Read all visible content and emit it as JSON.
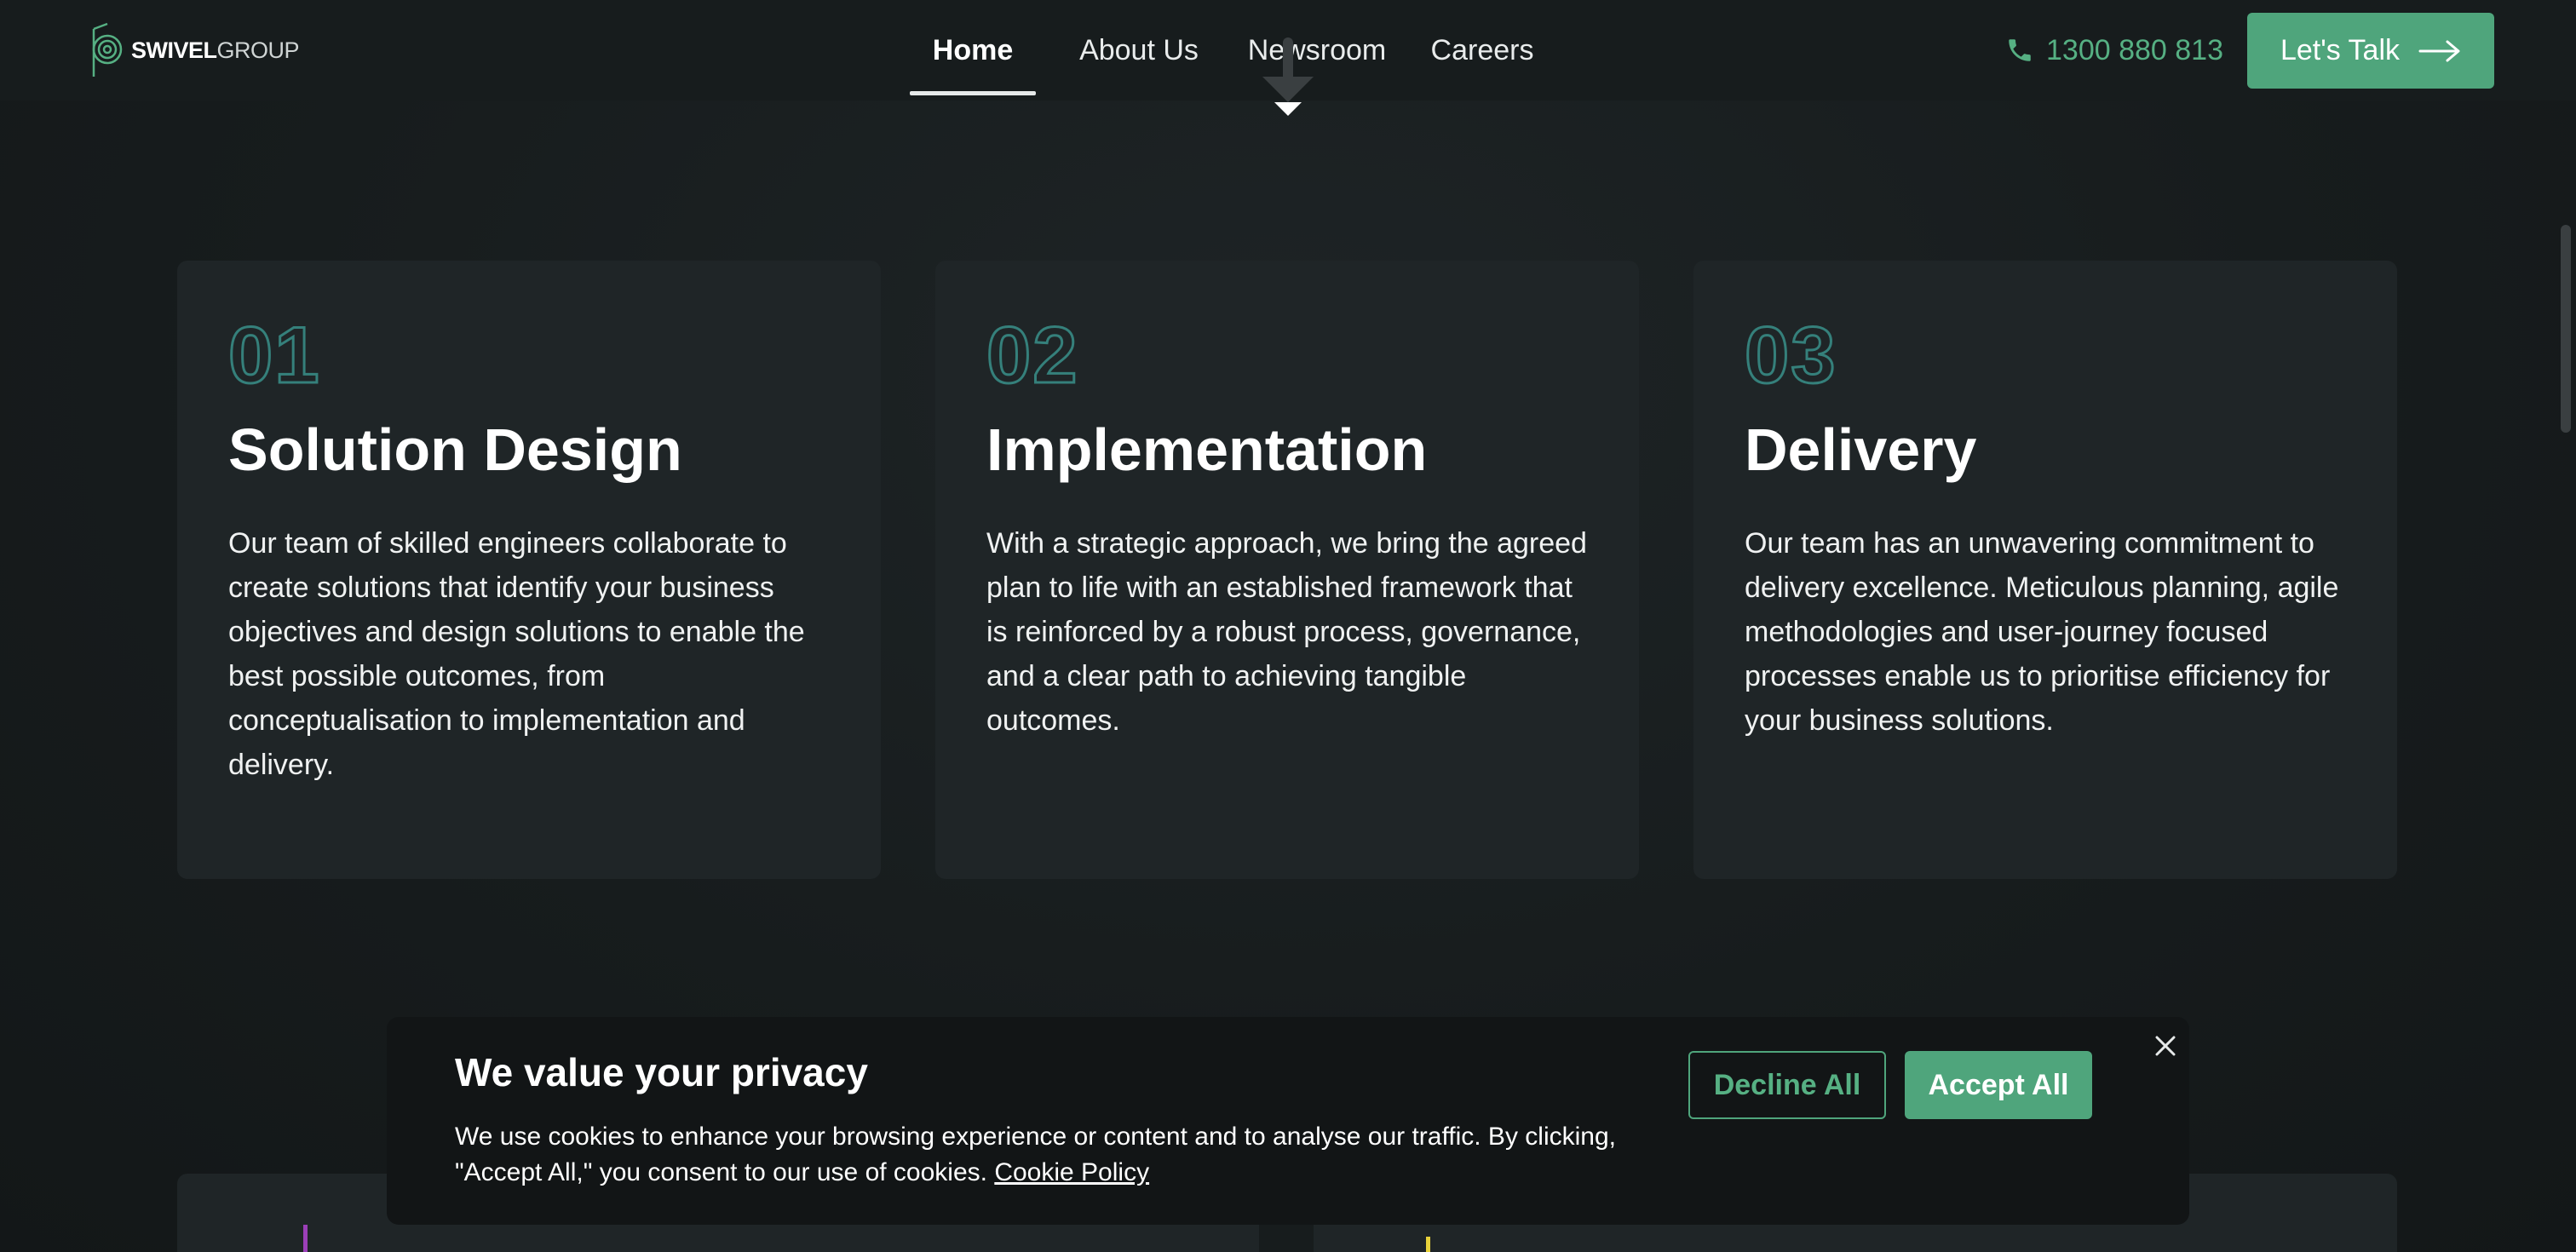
{
  "header": {
    "logo": {
      "brand_bold": "SWIVEL",
      "brand_light": "GROUP"
    },
    "nav": [
      {
        "label": "Home",
        "active": true
      },
      {
        "label": "About Us",
        "active": false
      },
      {
        "label": "Newsroom",
        "active": false
      },
      {
        "label": "Careers",
        "active": false
      }
    ],
    "phone": {
      "icon": "phone-icon",
      "number": "1300 880 813"
    },
    "cta": {
      "label": "Let's Talk",
      "icon": "arrow-right-icon"
    }
  },
  "cards": [
    {
      "number": "01",
      "title": "Solution Design",
      "body": "Our team of skilled engineers collaborate to create solutions that identify your business objectives and design solutions to enable the best possible outcomes, from conceptualisation to implementation and delivery."
    },
    {
      "number": "02",
      "title": "Implementation",
      "body": "With a strategic approach, we bring the agreed plan to life with an established framework that is reinforced by a robust process, governance, and a clear path to achieving tangible outcomes."
    },
    {
      "number": "03",
      "title": "Delivery",
      "body": "Our team has an unwavering commitment to delivery excellence. Meticulous planning, agile methodologies and user-journey focused processes enable us to prioritise efficiency for your business solutions."
    }
  ],
  "cookie_banner": {
    "title": "We value your privacy",
    "text": "We use cookies to enhance your browsing experience or content and to analyse our traffic. By clicking, \"Accept All,\" you consent to our use of cookies.",
    "link_label": "Cookie Policy",
    "decline_label": "Decline All",
    "accept_label": "Accept All",
    "close_icon": "close-icon"
  },
  "colors": {
    "accent": "#4fa57c",
    "outline_number": "#35807b",
    "background": "#171c1d",
    "card": "#1f2527"
  }
}
